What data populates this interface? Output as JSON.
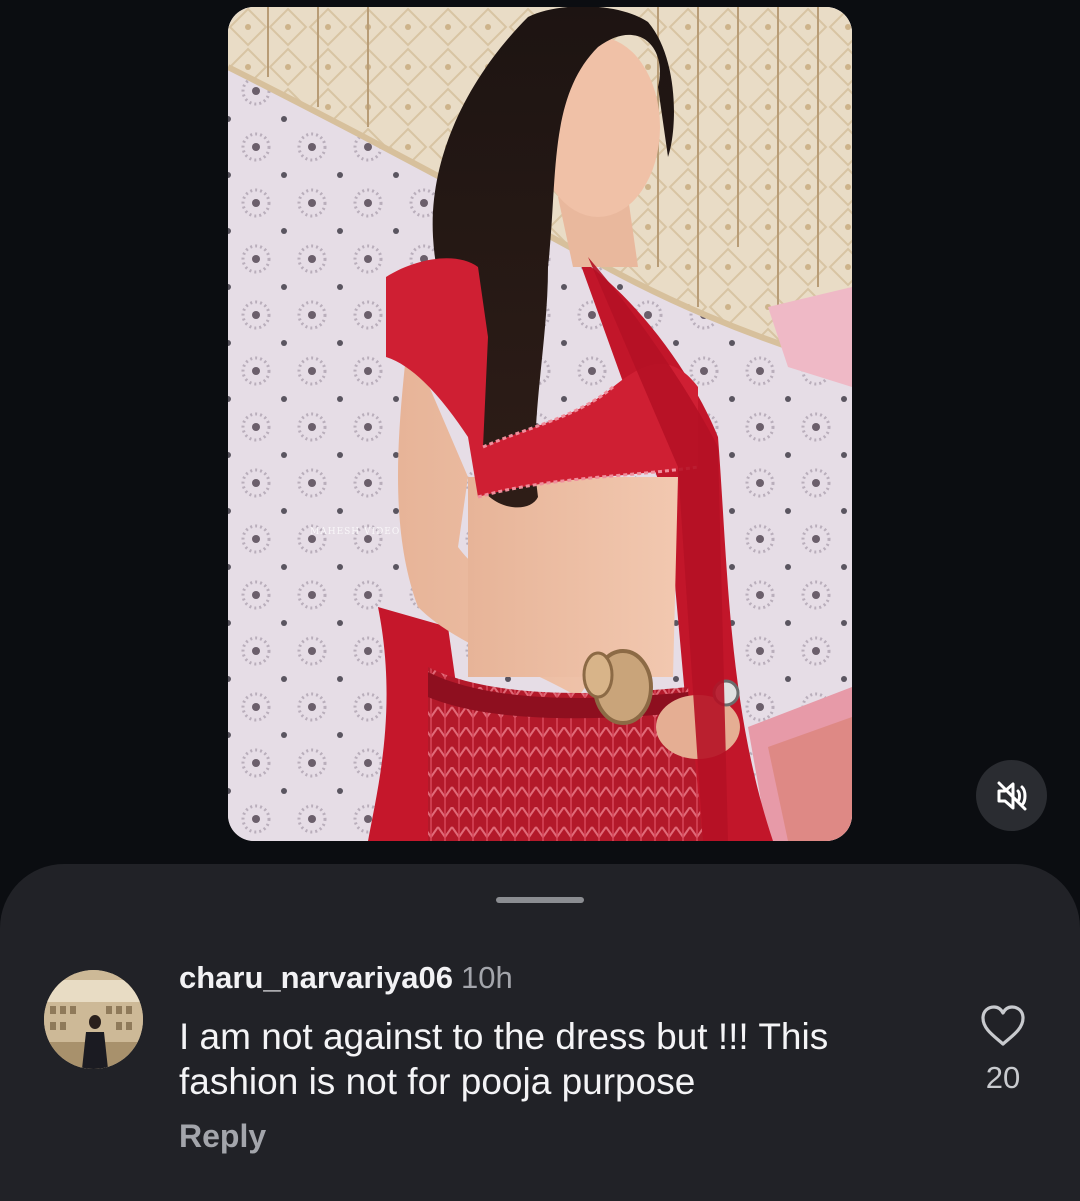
{
  "post": {
    "media_description_icon": "photo",
    "watermark_text": "MAHESH VIDEO",
    "mute_icon": "speaker-muted-icon"
  },
  "comment": {
    "username": "charu_narvariya06",
    "timestamp": "10h",
    "text": "I am not against to the dress but !!! This fashion is not for pooja purpose",
    "reply_label": "Reply",
    "like_icon": "heart-outline-icon",
    "like_count": "20"
  },
  "colors": {
    "background": "#0b0d11",
    "sheet": "#212227",
    "text_primary": "#f4f4f6",
    "text_secondary": "#a3a5ab"
  }
}
